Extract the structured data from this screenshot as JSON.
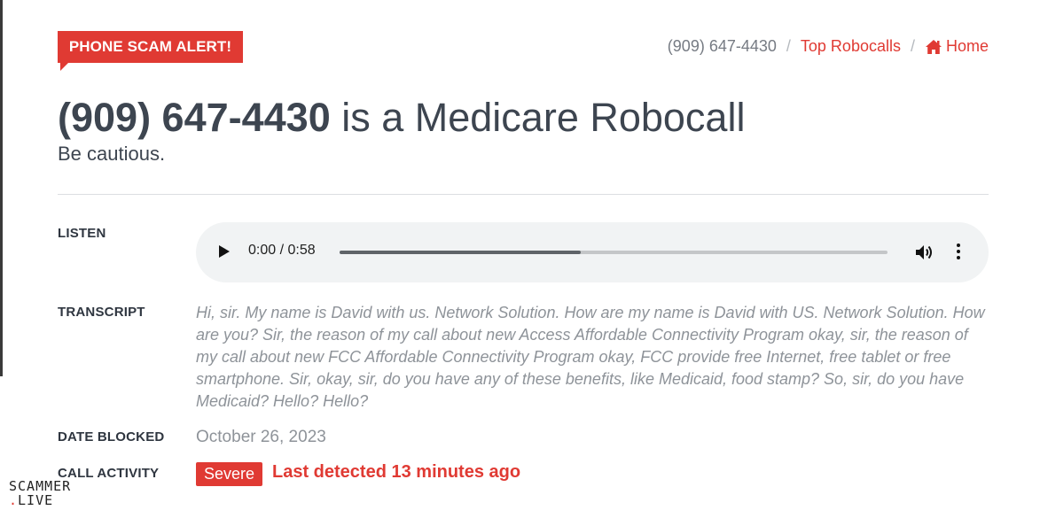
{
  "alert_badge": "PHONE SCAM ALERT!",
  "breadcrumb": {
    "current": "(909) 647-4430",
    "separator": "/",
    "top_robocalls": "Top Robocalls",
    "home": "Home",
    "home_icon": "home-icon"
  },
  "title": {
    "number": "(909) 647-4430",
    "suffix": " is a Medicare Robocall"
  },
  "subtitle": "Be cautious.",
  "listen": {
    "label": "LISTEN",
    "time": "0:00 / 0:58",
    "progress": 0.44,
    "icons": [
      "play-icon",
      "volume-icon",
      "more-vertical-icon"
    ]
  },
  "transcript": {
    "label": "TRANSCRIPT",
    "text": "Hi, sir. My name is David with us. Network Solution. How are my name is David with US. Network Solution. How are you? Sir, the reason of my call about new Access Affordable Connectivity Program okay, sir, the reason of my call about new FCC Affordable Connectivity Program okay, FCC provide free Internet, free tablet or free smartphone. Sir, okay, sir, do you have any of these benefits, like Medicaid, food stamp? So, sir, do you have Medicaid? Hello? Hello?"
  },
  "date_blocked": {
    "label": "DATE BLOCKED",
    "value": "October 26, 2023"
  },
  "call_activity": {
    "label": "CALL ACTIVITY",
    "badge": "Severe",
    "detail": "Last detected 13 minutes ago"
  },
  "watermark": {
    "line1": "SCAMMER",
    "line2_dot": ".",
    "line2": "LIVE"
  },
  "colors": {
    "accent": "#e03a33",
    "text": "#3d4550",
    "muted": "#8e9399"
  }
}
